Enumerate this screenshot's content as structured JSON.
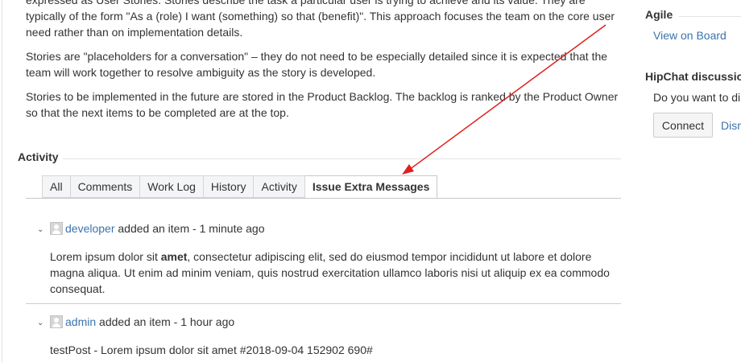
{
  "description": {
    "paragraphs": [
      "expressed as User Stories. Stories describe the task a particular user is trying to achieve and its value. They are typically of the form \"As a (role) I want (something) so that (benefit)\". This approach focuses the team on the core user need rather than on implementation details.",
      "Stories are \"placeholders for a conversation\" – they do not need to be especially detailed since it is expected that the team will work together to resolve ambiguity as the story is developed.",
      "Stories to be implemented in the future are stored in the Product Backlog. The backlog is ranked by the Product Owner so that the next items to be completed are at the top."
    ]
  },
  "activity": {
    "heading": "Activity",
    "tabs": [
      {
        "label": "All"
      },
      {
        "label": "Comments"
      },
      {
        "label": "Work Log"
      },
      {
        "label": "History"
      },
      {
        "label": "Activity"
      },
      {
        "label": "Issue Extra Messages",
        "active": true
      }
    ],
    "entries": [
      {
        "user": "developer",
        "action": "added an item - 1 minute ago",
        "body_before": "Lorem ipsum dolor sit ",
        "body_bold": "amet",
        "body_after": ", consectetur adipiscing elit, sed do eiusmod tempor incididunt ut labore et dolore magna aliqua. Ut enim ad minim veniam, quis nostrud exercitation ullamco laboris nisi ut aliquip ex ea commodo consequat."
      },
      {
        "user": "admin",
        "action": "added an item - 1 hour ago",
        "body": "testPost - Lorem ipsum dolor sit amet #2018-09-04 152902 690#"
      }
    ]
  },
  "sidebar": {
    "agile": {
      "heading": "Agile",
      "link": "View on Board"
    },
    "hipchat": {
      "heading": "HipChat discussio",
      "text": "Do you want to di",
      "connect_label": "Connect",
      "dismiss_label": "Dism"
    }
  },
  "colors": {
    "link": "#3b73af",
    "annotation_arrow": "#e02020"
  },
  "icons": {
    "chevron": "chevron-down-icon",
    "avatar": "user-avatar-icon"
  }
}
